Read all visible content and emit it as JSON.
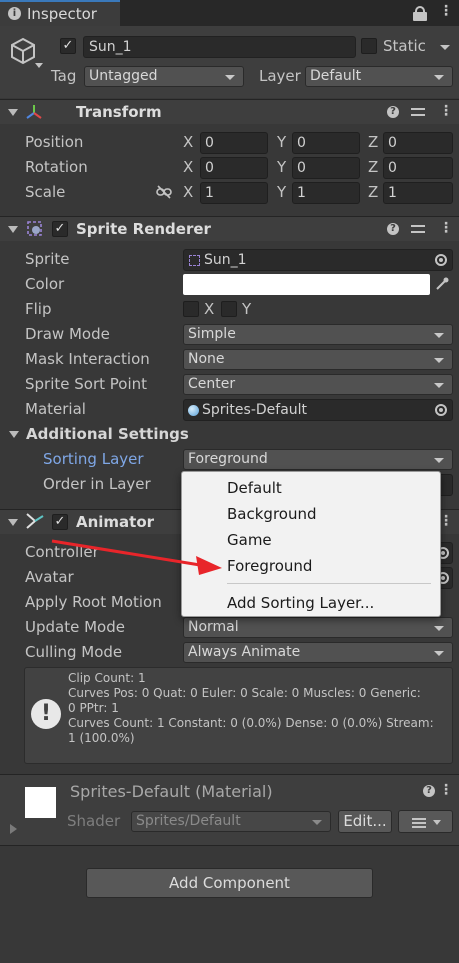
{
  "tab": {
    "title": "Inspector"
  },
  "object": {
    "name": "Sun_1",
    "static_label": "Static",
    "tag_label": "Tag",
    "tag_value": "Untagged",
    "layer_label": "Layer",
    "layer_value": "Default"
  },
  "transform": {
    "title": "Transform",
    "position": {
      "label": "Position",
      "x": "0",
      "y": "0",
      "z": "0"
    },
    "rotation": {
      "label": "Rotation",
      "x": "0",
      "y": "0",
      "z": "0"
    },
    "scale": {
      "label": "Scale",
      "x": "1",
      "y": "1",
      "z": "1"
    },
    "axis_x": "X",
    "axis_y": "Y",
    "axis_z": "Z"
  },
  "sprite_renderer": {
    "title": "Sprite Renderer",
    "sprite_label": "Sprite",
    "sprite_value": "Sun_1",
    "color_label": "Color",
    "color_value": "#ffffff",
    "flip_label": "Flip",
    "flip_x": "X",
    "flip_y": "Y",
    "draw_mode_label": "Draw Mode",
    "draw_mode_value": "Simple",
    "mask_label": "Mask Interaction",
    "mask_value": "None",
    "sort_point_label": "Sprite Sort Point",
    "sort_point_value": "Center",
    "material_label": "Material",
    "material_value": "Sprites-Default",
    "additional_settings": "Additional Settings",
    "sorting_layer_label": "Sorting Layer",
    "sorting_layer_value": "Foreground",
    "order_label": "Order in Layer"
  },
  "sorting_popup": {
    "items": [
      "Default",
      "Background",
      "Game",
      "Foreground"
    ],
    "add_label": "Add Sorting Layer..."
  },
  "animator": {
    "title": "Animator",
    "controller_label": "Controller",
    "avatar_label": "Avatar",
    "apply_root_label": "Apply Root Motion",
    "update_mode_label": "Update Mode",
    "update_mode_value": "Normal",
    "culling_mode_label": "Culling Mode",
    "culling_mode_value": "Always Animate",
    "info_lines": [
      "Clip Count: 1",
      "Curves Pos: 0 Quat: 0 Euler: 0 Scale: 0 Muscles: 0 Generic:",
      "0 PPtr: 1",
      "Curves Count: 1 Constant: 0 (0.0%) Dense: 0 (0.0%) Stream:",
      "1 (100.0%)"
    ]
  },
  "material": {
    "title": "Sprites-Default (Material)",
    "shader_label": "Shader",
    "shader_value": "Sprites/Default",
    "edit_label": "Edit..."
  },
  "add_component": {
    "label": "Add Component"
  },
  "colors": {
    "accent_blue": "#7fa7e6",
    "arrow_red": "#e8252a",
    "panel": "#383838"
  }
}
